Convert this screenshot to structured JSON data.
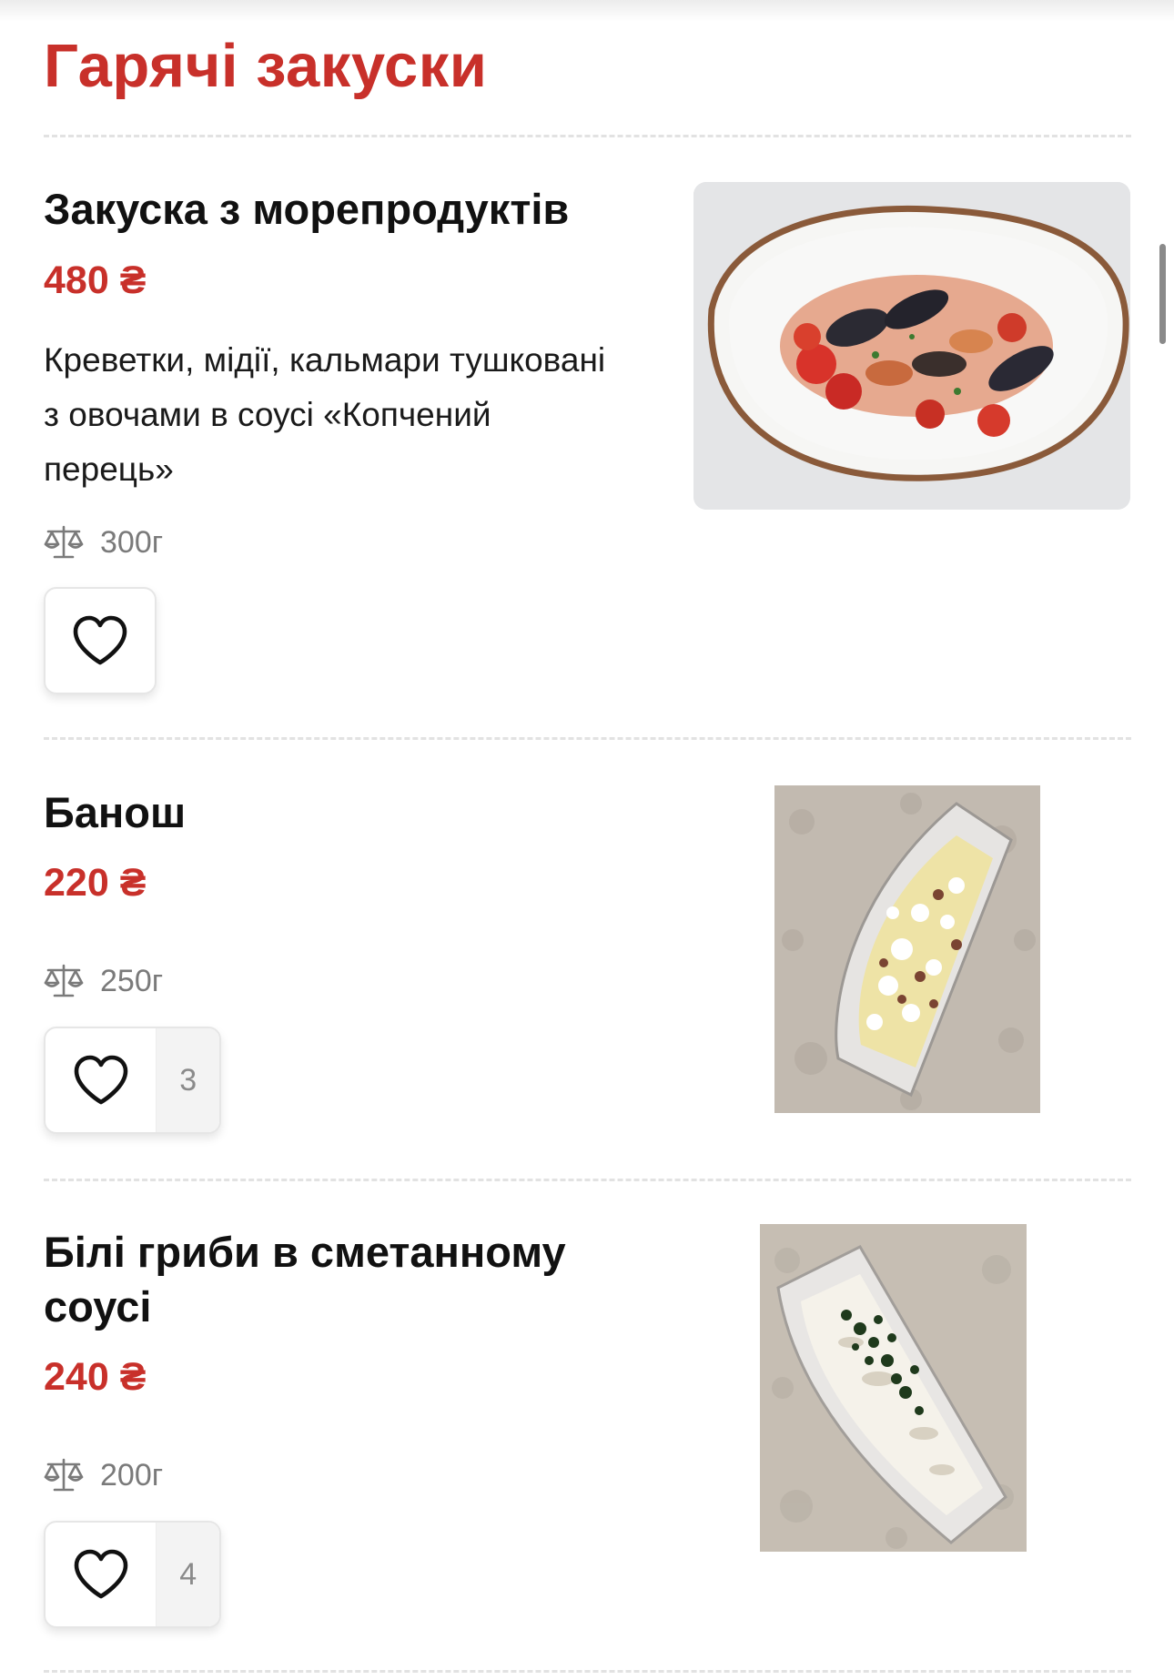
{
  "section": {
    "title": "Гарячі закуски"
  },
  "items": [
    {
      "name": "Закуска з морепродуктів",
      "price": "480 ₴",
      "description": "Креветки, мідії, кальмари тушковані з овочами в соусі «Копчений перець»",
      "weight": "300г",
      "likes": null,
      "photo": "seafood-plate-photo"
    },
    {
      "name": "Банош",
      "price": "220 ₴",
      "description": "",
      "weight": "250г",
      "likes": "3",
      "photo": "banosh-dish-photo"
    },
    {
      "name": "Білі гриби в сметанному соусі",
      "price": "240 ₴",
      "description": "",
      "weight": "200г",
      "likes": "4",
      "photo": "mushroom-dish-photo"
    }
  ],
  "icons": {
    "weight": "scale-icon",
    "like": "heart-icon"
  },
  "colors": {
    "accent": "#c8302a",
    "text": "#111111",
    "muted": "#7a7a7a",
    "divider": "#e2e2e2"
  }
}
